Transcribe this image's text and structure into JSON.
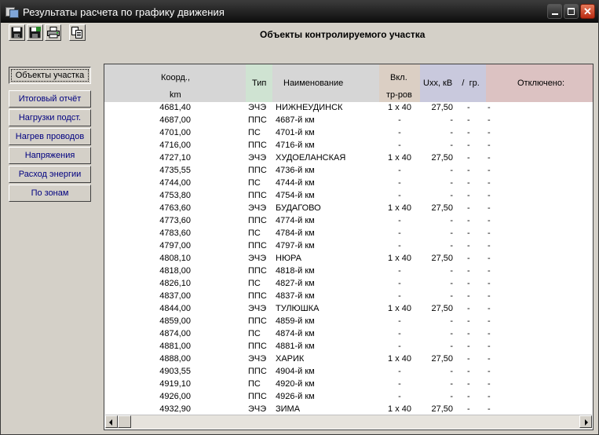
{
  "window": {
    "title": "Результаты расчета по графику движения",
    "buttons": [
      "minimize",
      "maximize",
      "close"
    ]
  },
  "toolbar": {
    "icons": [
      "save-icon",
      "save-as-icon",
      "print-icon",
      "copy-icon"
    ]
  },
  "form_title": "Объекты контролируемого участка",
  "sidebar": {
    "items": [
      {
        "label": "Объекты участка",
        "active": true
      },
      {
        "label": "Итоговый отчёт",
        "active": false
      },
      {
        "label": "Нагрузки подст.",
        "active": false
      },
      {
        "label": "Нагрев проводов",
        "active": false
      },
      {
        "label": "Напряжения",
        "active": false
      },
      {
        "label": "Расход энергии",
        "active": false
      },
      {
        "label": "По  зонам",
        "active": false
      }
    ]
  },
  "table": {
    "headers": {
      "coord_line1": "Коорд.,",
      "coord_line2": "km",
      "type": "Тип",
      "name": "Наименование",
      "switch_line1": "Вкл.",
      "switch_line2": "тр-ров",
      "voltage": "Uxx, кВ    /  гр.",
      "disconnected": "Отключено:"
    },
    "header_colors": {
      "coord": "#d6d6d6",
      "type": "#cfe3d2",
      "name": "#d6d6d6",
      "switch": "#dbcfc4",
      "voltage": "#c9c9dd",
      "disconnected": "#dcc2c2"
    },
    "rows": [
      [
        "4681,40",
        "ЭЧЭ",
        "НИЖНЕУДИНСК",
        "1 х 40",
        "27,50",
        "-",
        "-"
      ],
      [
        "4687,00",
        "ППС",
        "4687-й км",
        "-",
        "-",
        "-",
        "-"
      ],
      [
        "4701,00",
        "ПС",
        "4701-й км",
        "-",
        "-",
        "-",
        "-"
      ],
      [
        "4716,00",
        "ППС",
        "4716-й км",
        "-",
        "-",
        "-",
        "-"
      ],
      [
        "4727,10",
        "ЭЧЭ",
        "ХУДОЕЛАНСКАЯ",
        "1 х 40",
        "27,50",
        "-",
        "-"
      ],
      [
        "4735,55",
        "ППС",
        "4736-й км",
        "-",
        "-",
        "-",
        "-"
      ],
      [
        "4744,00",
        "ПС",
        "4744-й км",
        "-",
        "-",
        "-",
        "-"
      ],
      [
        "4753,80",
        "ППС",
        "4754-й км",
        "-",
        "-",
        "-",
        "-"
      ],
      [
        "4763,60",
        "ЭЧЭ",
        "БУДАГОВО",
        "1 х 40",
        "27,50",
        "-",
        "-"
      ],
      [
        "4773,60",
        "ППС",
        "4774-й км",
        "-",
        "-",
        "-",
        "-"
      ],
      [
        "4783,60",
        "ПС",
        "4784-й км",
        "-",
        "-",
        "-",
        "-"
      ],
      [
        "4797,00",
        "ППС",
        "4797-й км",
        "-",
        "-",
        "-",
        "-"
      ],
      [
        "4808,10",
        "ЭЧЭ",
        "НЮРА",
        "1 х 40",
        "27,50",
        "-",
        "-"
      ],
      [
        "4818,00",
        "ППС",
        "4818-й км",
        "-",
        "-",
        "-",
        "-"
      ],
      [
        "4826,10",
        "ПС",
        "4827-й км",
        "-",
        "-",
        "-",
        "-"
      ],
      [
        "4837,00",
        "ППС",
        "4837-й км",
        "-",
        "-",
        "-",
        "-"
      ],
      [
        "4844,00",
        "ЭЧЭ",
        "ТУЛЮШКА",
        "1 х 40",
        "27,50",
        "-",
        "-"
      ],
      [
        "4859,00",
        "ППС",
        "4859-й км",
        "-",
        "-",
        "-",
        "-"
      ],
      [
        "4874,00",
        "ПС",
        "4874-й км",
        "-",
        "-",
        "-",
        "-"
      ],
      [
        "4881,00",
        "ППС",
        "4881-й км",
        "-",
        "-",
        "-",
        "-"
      ],
      [
        "4888,00",
        "ЭЧЭ",
        "ХАРИК",
        "1 х 40",
        "27,50",
        "-",
        "-"
      ],
      [
        "4903,55",
        "ППС",
        "4904-й км",
        "-",
        "-",
        "-",
        "-"
      ],
      [
        "4919,10",
        "ПС",
        "4920-й км",
        "-",
        "-",
        "-",
        "-"
      ],
      [
        "4926,00",
        "ППС",
        "4926-й км",
        "-",
        "-",
        "-",
        "-"
      ],
      [
        "4932,90",
        "ЭЧЭ",
        "ЗИМА",
        "1 х 40",
        "27,50",
        "-",
        "-"
      ]
    ]
  }
}
